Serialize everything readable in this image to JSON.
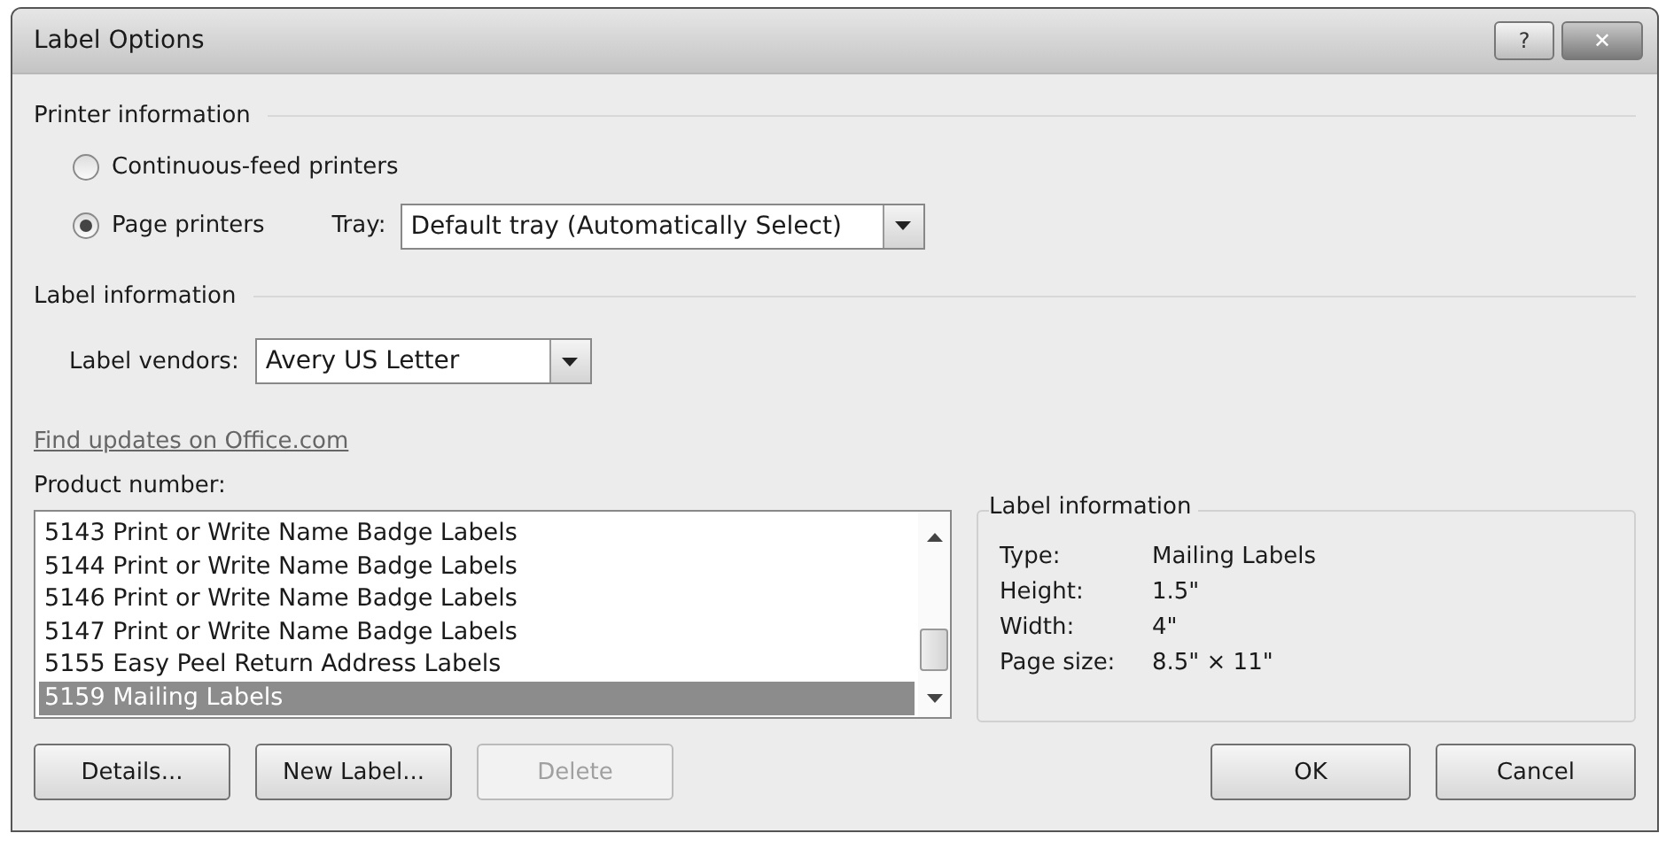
{
  "window": {
    "title": "Label Options",
    "help_button": "?",
    "close_button": "✕"
  },
  "printer_information": {
    "heading": "Printer information",
    "options": [
      {
        "label": "Continuous-feed printers",
        "selected": false
      },
      {
        "label": "Page printers",
        "selected": true
      }
    ],
    "tray": {
      "label": "Tray:",
      "value": "Default tray (Automatically Select)"
    }
  },
  "label_information": {
    "heading": "Label information",
    "vendors": {
      "label": "Label vendors:",
      "value": "Avery US Letter"
    },
    "link": "Find updates on Office.com"
  },
  "product_number": {
    "label": "Product number:",
    "items": [
      {
        "text": "5143 Print or Write Name Badge Labels",
        "selected": false
      },
      {
        "text": "5144 Print or Write Name Badge Labels",
        "selected": false
      },
      {
        "text": "5146 Print or Write Name Badge Labels",
        "selected": false
      },
      {
        "text": "5147 Print or Write Name Badge Labels",
        "selected": false
      },
      {
        "text": "5155 Easy Peel Return Address Labels",
        "selected": false
      },
      {
        "text": "5159 Mailing Labels",
        "selected": true
      }
    ]
  },
  "details_panel": {
    "heading": "Label information",
    "rows": [
      {
        "label": "Type:",
        "value": "Mailing Labels"
      },
      {
        "label": "Height:",
        "value": "1.5\""
      },
      {
        "label": "Width:",
        "value": "4\""
      },
      {
        "label": "Page size:",
        "value": "8.5\" × 11\""
      }
    ]
  },
  "buttons": [
    {
      "label": "Details...",
      "disabled": false
    },
    {
      "label": "New Label...",
      "disabled": false
    },
    {
      "label": "Delete",
      "disabled": true
    },
    {
      "label": "OK",
      "disabled": false
    },
    {
      "label": "Cancel",
      "disabled": false
    }
  ]
}
